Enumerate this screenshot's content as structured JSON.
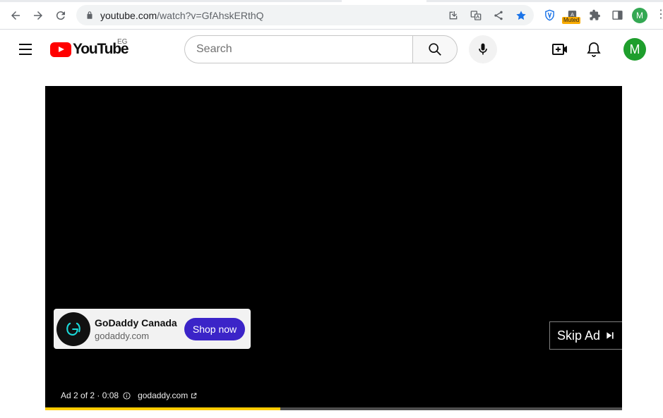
{
  "browser": {
    "url_host": "youtube.com",
    "url_path": "/watch?v=GfAhskERthQ",
    "muted_badge": "Muted",
    "profile_initial": "M",
    "icons": [
      "back-icon",
      "forward-icon",
      "reload-icon",
      "lock-icon",
      "download-icon",
      "translate-icon",
      "share-icon",
      "bookmark-star-icon",
      "shield-extension-icon",
      "muted-extension-icon",
      "puzzle-icon",
      "side-panel-icon",
      "more-vert-icon"
    ]
  },
  "masthead": {
    "logo_text": "YouTube",
    "country_code": "EG",
    "search_placeholder": "Search",
    "avatar_initial": "M",
    "colors": {
      "logo_red": "#ff0000",
      "avatar_bg": "#1e9e2c"
    }
  },
  "player": {
    "ad_card": {
      "title": "GoDaddy Canada",
      "domain": "godaddy.com",
      "cta_label": "Shop now",
      "cta_color": "#3b24c8"
    },
    "skip_label": "Skip Ad",
    "ad_status": "Ad 2 of 2 · 0:08",
    "ad_link": "godaddy.com",
    "progress_fraction": 0.407,
    "progress_color": "#ffcc00"
  }
}
